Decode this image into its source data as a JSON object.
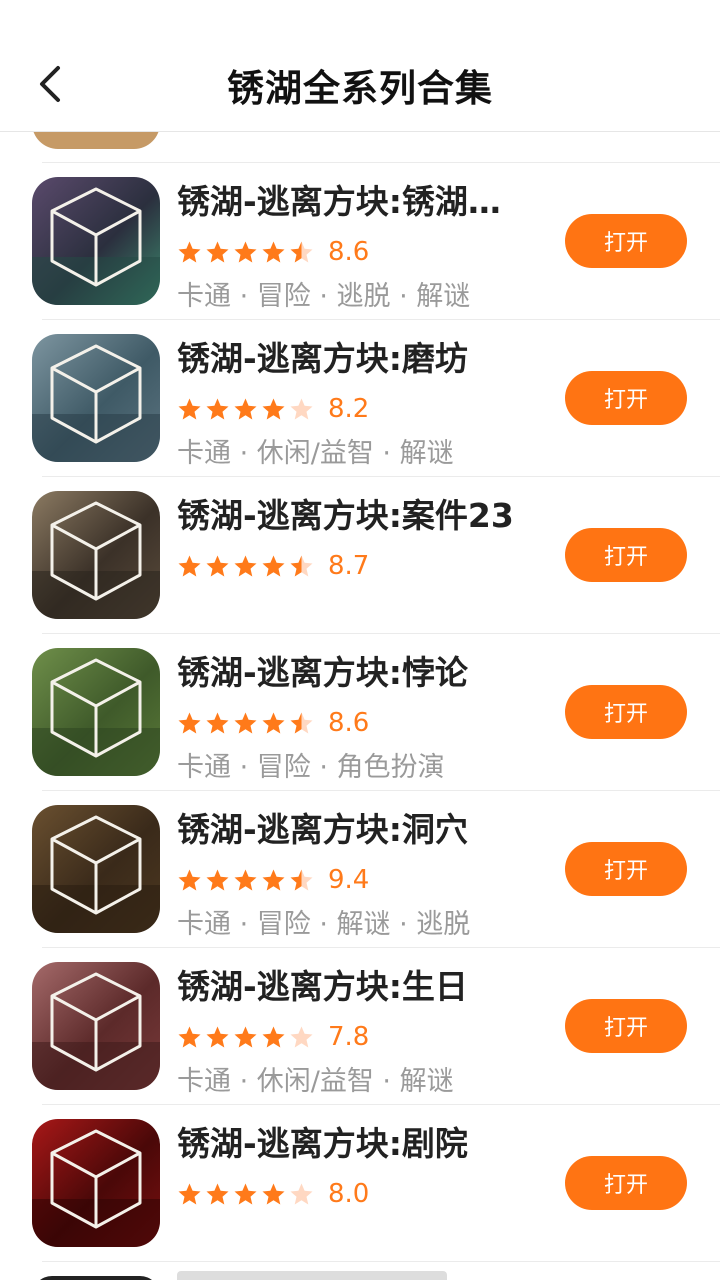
{
  "header": {
    "title": "锈湖全系列合集"
  },
  "colors": {
    "accent": "#ff7413",
    "star": "#ff7a1a",
    "star_empty": "#ffd8c2"
  },
  "apps": [
    {
      "name": "锈湖-逃离方块:锈湖…",
      "score": "8.6",
      "rating": 4.5,
      "tags": "卡通 · 冒险 · 逃脱 · 解谜",
      "button": "打开",
      "icon_theme": "lake",
      "icon": "cube-lake-icon"
    },
    {
      "name": "锈湖-逃离方块:磨坊",
      "score": "8.2",
      "rating": 4,
      "tags": "卡通 · 休闲/益智 · 解谜",
      "button": "打开",
      "icon_theme": "mill",
      "icon": "cube-mill-icon"
    },
    {
      "name": "锈湖-逃离方块:案件23",
      "score": "8.7",
      "rating": 4.5,
      "tags": "",
      "button": "打开",
      "icon_theme": "case",
      "icon": "cube-case-icon"
    },
    {
      "name": "锈湖-逃离方块:悖论",
      "score": "8.6",
      "rating": 4.5,
      "tags": "卡通 · 冒险 · 角色扮演",
      "button": "打开",
      "icon_theme": "paradox",
      "icon": "cube-paradox-icon"
    },
    {
      "name": "锈湖-逃离方块:洞穴",
      "score": "9.4",
      "rating": 4.5,
      "tags": "卡通 · 冒险 · 解谜 · 逃脱",
      "button": "打开",
      "icon_theme": "cave",
      "icon": "cube-cave-icon"
    },
    {
      "name": "锈湖-逃离方块:生日",
      "score": "7.8",
      "rating": 4,
      "tags": "卡通 · 休闲/益智 · 解谜",
      "button": "打开",
      "icon_theme": "birthday",
      "icon": "cube-birthday-icon"
    },
    {
      "name": "锈湖-逃离方块:剧院",
      "score": "8.0",
      "rating": 4,
      "tags": "",
      "button": "打开",
      "icon_theme": "theatre",
      "icon": "cube-theatre-icon"
    }
  ]
}
